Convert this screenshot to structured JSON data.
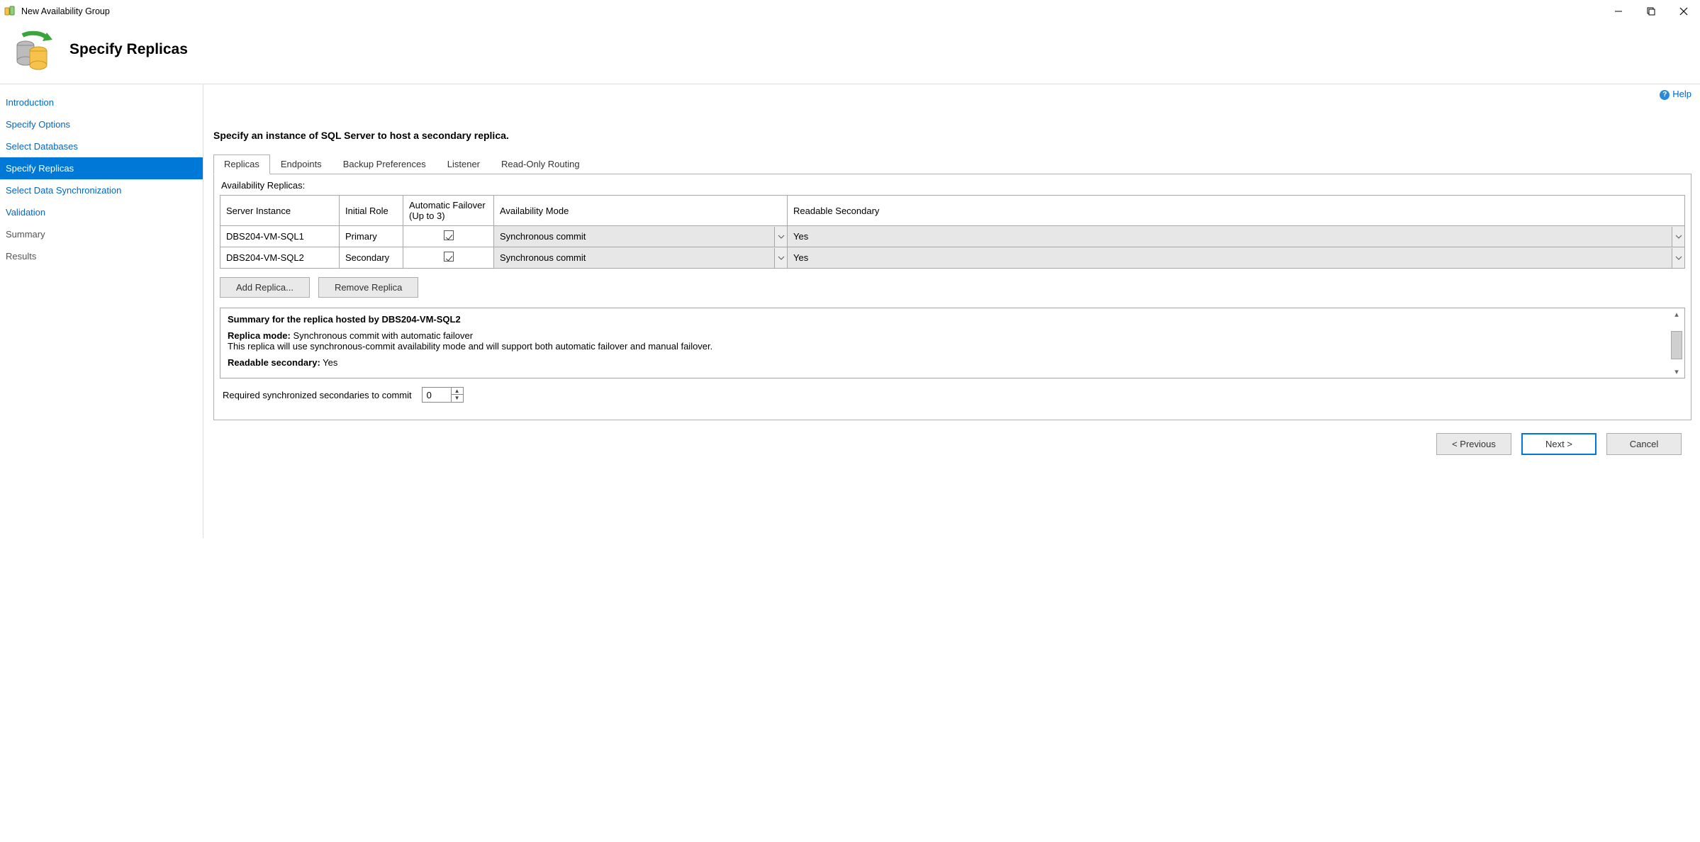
{
  "window": {
    "title": "New Availability Group"
  },
  "header": {
    "title": "Specify Replicas"
  },
  "help": {
    "label": "Help"
  },
  "sidebar": {
    "items": [
      {
        "label": "Introduction",
        "style": "link"
      },
      {
        "label": "Specify Options",
        "style": "link"
      },
      {
        "label": "Select Databases",
        "style": "link"
      },
      {
        "label": "Specify Replicas",
        "style": "active"
      },
      {
        "label": "Select Data Synchronization",
        "style": "link"
      },
      {
        "label": "Validation",
        "style": "link"
      },
      {
        "label": "Summary",
        "style": "plain"
      },
      {
        "label": "Results",
        "style": "plain"
      }
    ]
  },
  "main": {
    "instruction": "Specify an instance of SQL Server to host a secondary replica.",
    "tabs": [
      {
        "label": "Replicas",
        "active": true
      },
      {
        "label": "Endpoints"
      },
      {
        "label": "Backup Preferences"
      },
      {
        "label": "Listener"
      },
      {
        "label": "Read-Only Routing"
      }
    ],
    "replicas": {
      "section_label": "Availability Replicas:",
      "columns": {
        "server": "Server Instance",
        "role": "Initial Role",
        "auto_failover": "Automatic Failover (Up to 3)",
        "avail_mode": "Availability Mode",
        "readable": "Readable Secondary"
      },
      "rows": [
        {
          "server": "DBS204-VM-SQL1",
          "role": "Primary",
          "auto_failover": true,
          "avail_mode": "Synchronous commit",
          "readable": "Yes"
        },
        {
          "server": "DBS204-VM-SQL2",
          "role": "Secondary",
          "auto_failover": true,
          "avail_mode": "Synchronous commit",
          "readable": "Yes"
        }
      ],
      "buttons": {
        "add": "Add Replica...",
        "remove": "Remove Replica"
      }
    },
    "summary": {
      "title": "Summary for the replica hosted by DBS204-VM-SQL2",
      "mode_label": "Replica mode:",
      "mode_value": "Synchronous commit with automatic failover",
      "mode_desc": "This replica will use synchronous-commit availability mode and will support both automatic failover and manual failover.",
      "readable_label": "Readable secondary:",
      "readable_value": "Yes"
    },
    "required_sync": {
      "label": "Required synchronized secondaries to commit",
      "value": "0"
    }
  },
  "footer": {
    "previous": "< Previous",
    "next": "Next >",
    "cancel": "Cancel"
  }
}
